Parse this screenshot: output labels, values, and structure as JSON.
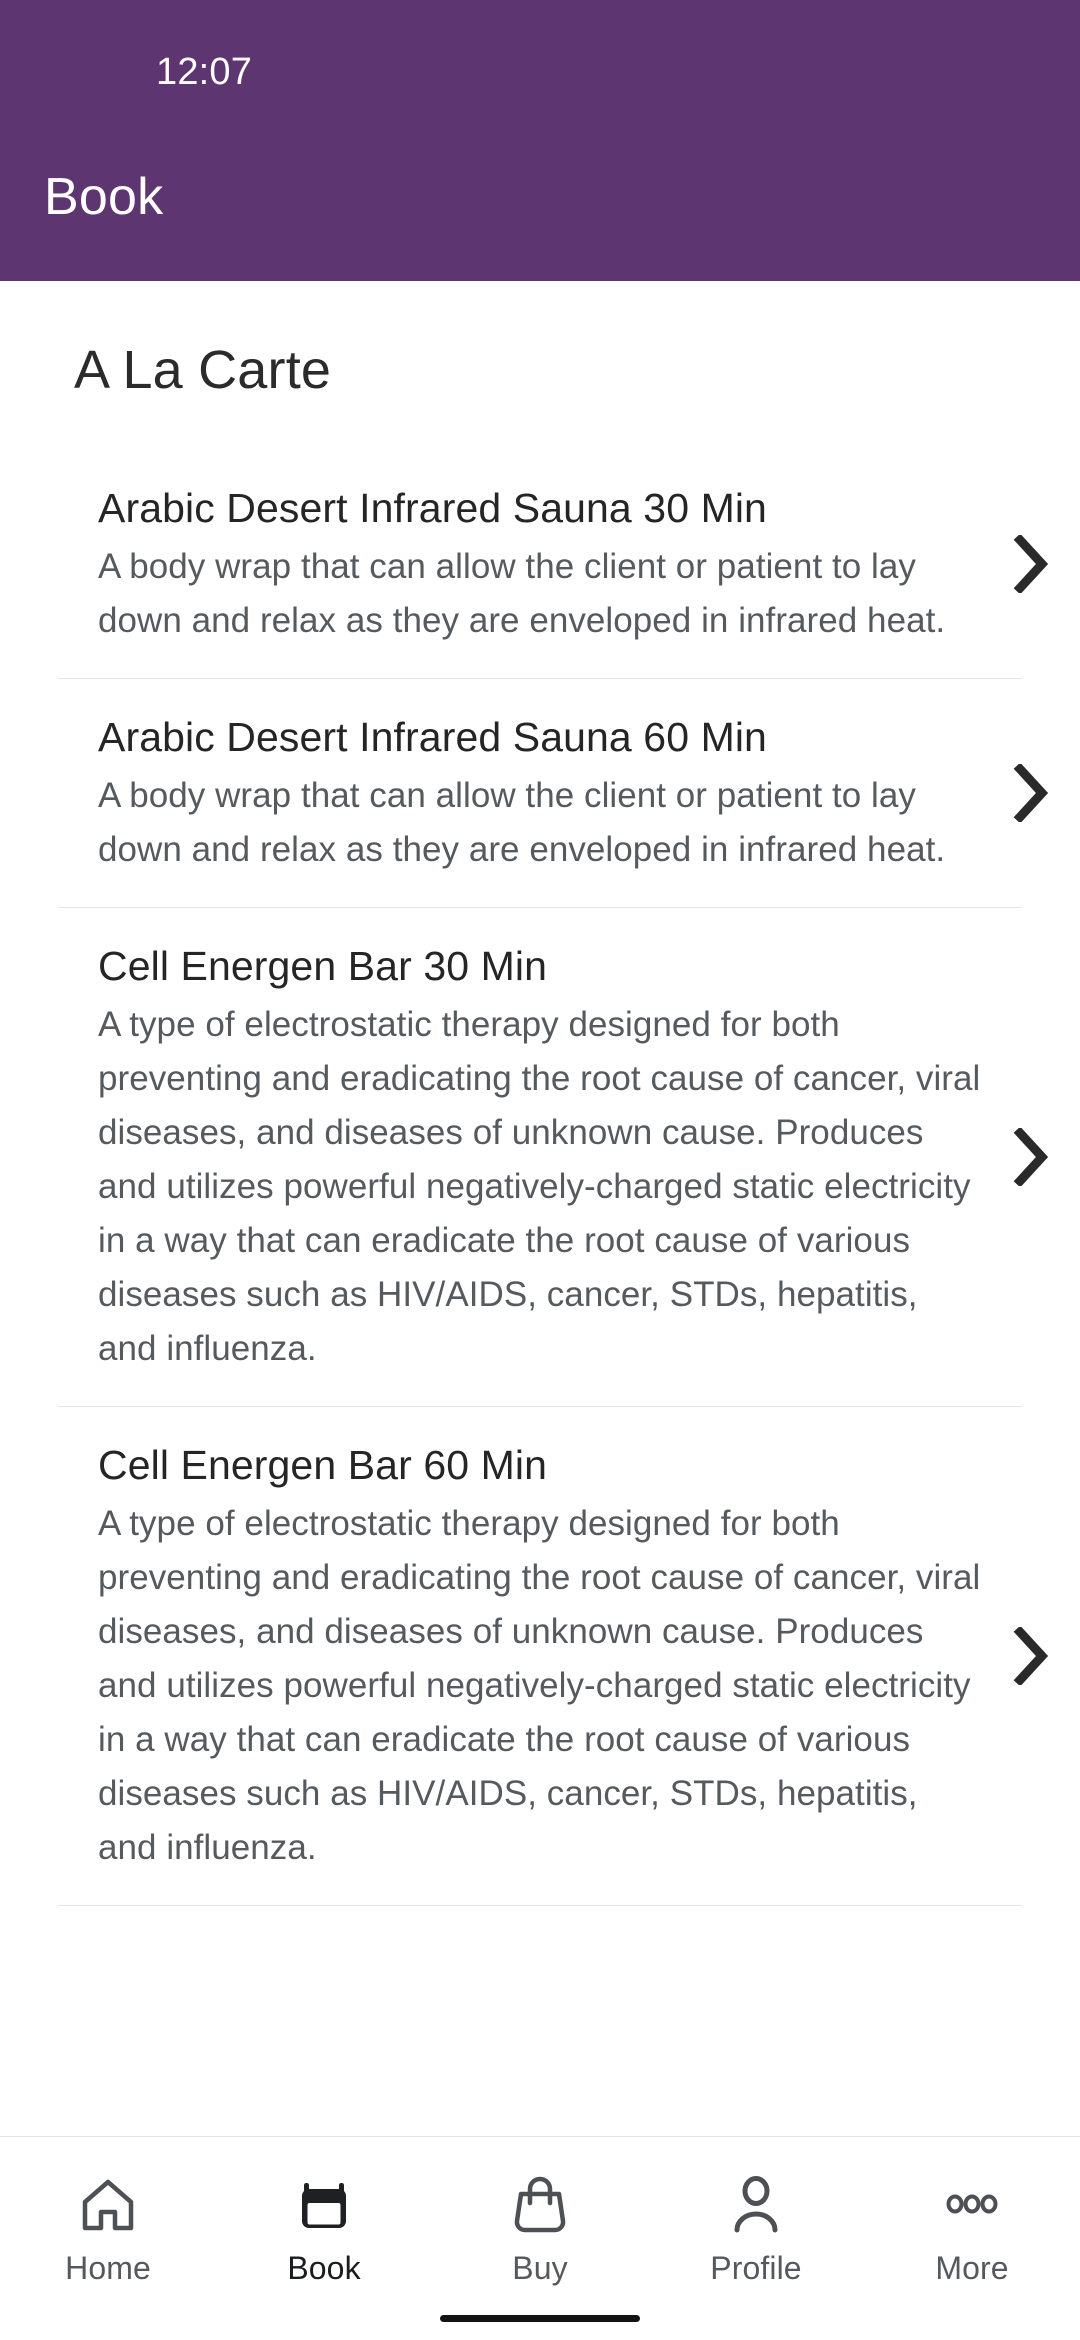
{
  "theme": {
    "appbar_color": "#5d3570",
    "page_background": "#ffffff",
    "title_color": "#252525",
    "description_color": "#555a5f",
    "divider_color": "#e6e6e6",
    "active_tab_color": "#1f2023",
    "inactive_tab_color": "#4d5055"
  },
  "status_bar": {
    "time": "12:07"
  },
  "appbar": {
    "title": "Book"
  },
  "main": {
    "section_title": "A La Carte",
    "items": [
      {
        "title": "Arabic Desert Infrared Sauna 30 Min",
        "description": "A body wrap that can allow the client or patient to lay down and relax as they are enveloped in infrared heat.",
        "chevron_icon": "chevron-right-icon"
      },
      {
        "title": "Arabic Desert Infrared Sauna 60 Min",
        "description": "A body wrap that can allow the client or patient to lay down and relax as they are enveloped in infrared heat.",
        "chevron_icon": "chevron-right-icon"
      },
      {
        "title": "Cell Energen Bar 30 Min",
        "description": "A type of electrostatic therapy designed for both preventing and eradicating the root cause of cancer, viral diseases, and diseases of unknown cause. Produces and utilizes powerful negatively-charged static electricity in a way that can eradicate the root cause of various diseases such as HIV/AIDS, cancer, STDs, hepatitis, and influenza.",
        "chevron_icon": "chevron-right-icon"
      },
      {
        "title": "Cell Energen Bar 60 Min",
        "description": "A type of electrostatic therapy designed for both preventing and eradicating the root cause of cancer, viral diseases, and diseases of unknown cause. Produces and utilizes powerful negatively-charged static electricity in a way that can eradicate the root cause of various diseases such as HIV/AIDS, cancer, STDs, hepatitis, and influenza.",
        "chevron_icon": "chevron-right-icon"
      }
    ]
  },
  "tabbar": {
    "active_index": 1,
    "items": [
      {
        "label": "Home",
        "icon": "home-icon"
      },
      {
        "label": "Book",
        "icon": "calendar-icon"
      },
      {
        "label": "Buy",
        "icon": "shopping-bag-icon"
      },
      {
        "label": "Profile",
        "icon": "person-icon"
      },
      {
        "label": "More",
        "icon": "ellipsis-icon"
      }
    ]
  }
}
